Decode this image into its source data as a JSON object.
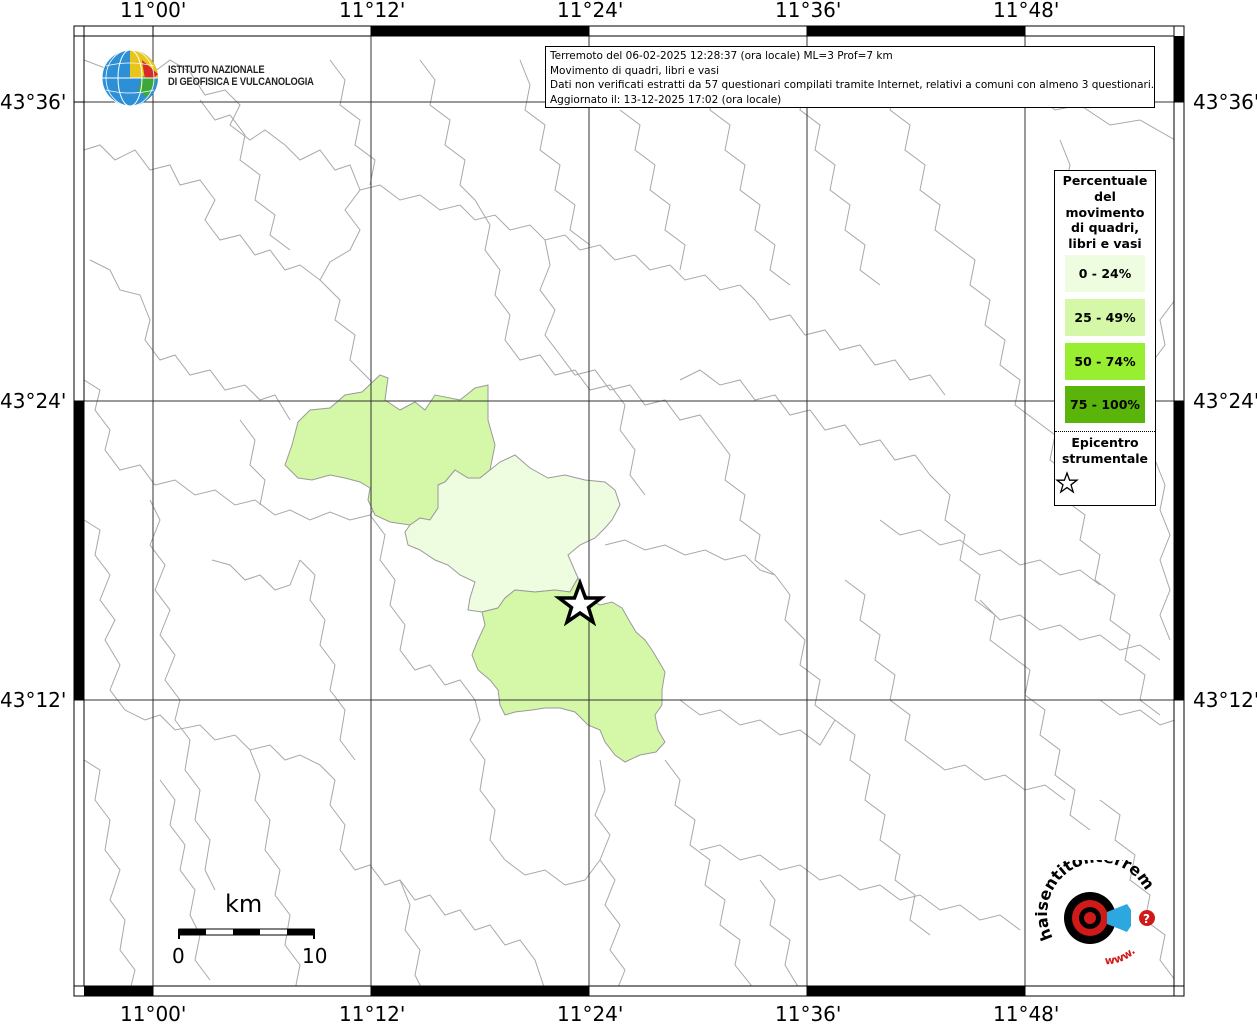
{
  "header": {
    "line1": "Terremoto del 06-02-2025 12:28:37 (ora locale) ML=3 Prof=7 km",
    "line2": "Movimento di quadri, libri e vasi",
    "line3": "Dati non verificati estratti da 57 questionari compilati tramite Internet, relativi a comuni con almeno 3 questionari.",
    "line4": "Aggiornato il: 13-12-2025 17:02 (ora locale)"
  },
  "ingv_logo": {
    "line1": "ISTITUTO NAZIONALE",
    "line2": "DI GEOFISICA E VULCANOLOGIA"
  },
  "longitude_labels": [
    "11°00'",
    "11°12'",
    "11°24'",
    "11°36'",
    "11°48'"
  ],
  "latitude_labels": [
    "43°36'",
    "43°24'",
    "43°12'"
  ],
  "legend": {
    "title": "Percentuale del movimento di quadri, libri e vasi",
    "title_lines": [
      "Percentuale",
      "del",
      "movimento",
      "di quadri,",
      "libri e vasi"
    ],
    "items": [
      {
        "label": "0 - 24%",
        "color": "#eefce0"
      },
      {
        "label": "25 - 49%",
        "color": "#d4f8a8"
      },
      {
        "label": "50 - 74%",
        "color": "#98ee30"
      },
      {
        "label": "75 - 100%",
        "color": "#5ab40a"
      }
    ],
    "epicenter_lines": [
      "Epicentro",
      "strumentale"
    ]
  },
  "scale_bar": {
    "unit": "km",
    "start": "0",
    "end": "10"
  },
  "hst_logo": {
    "text": "haisentitoilterremoto.it",
    "www": "www."
  },
  "colors": {
    "border_gray": "#aaaaaa",
    "grid": "#333333",
    "frame": "#000000"
  }
}
